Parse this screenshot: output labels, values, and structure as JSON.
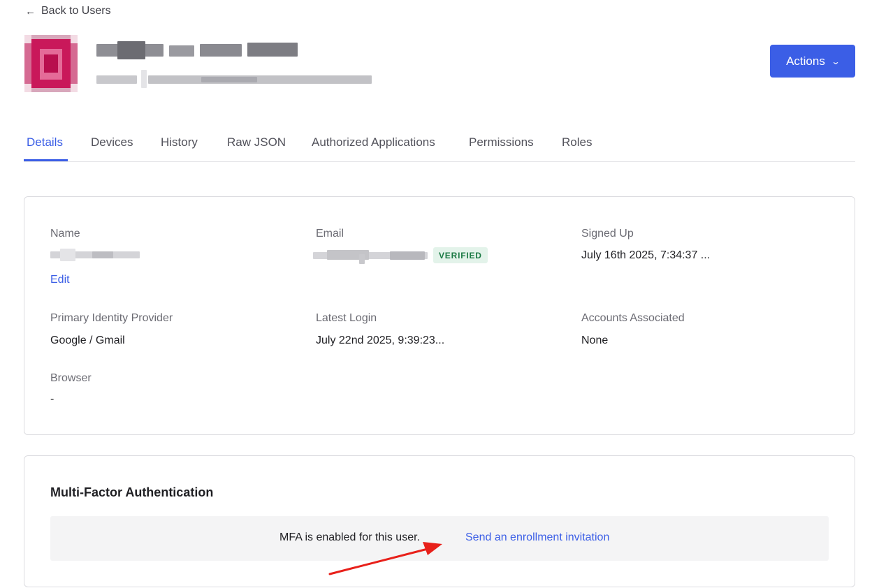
{
  "header": {
    "back_label": "Back to Users",
    "back_icon": "arrow-left-icon",
    "actions_label": "Actions",
    "actions_icon": "chevron-down-icon",
    "accent_color": "#3b5ee6"
  },
  "tabs": [
    {
      "label": "Details",
      "active": true
    },
    {
      "label": "Devices",
      "active": false
    },
    {
      "label": "History",
      "active": false
    },
    {
      "label": "Raw JSON",
      "active": false
    },
    {
      "label": "Authorized Applications",
      "active": false
    },
    {
      "label": "Permissions",
      "active": false
    },
    {
      "label": "Roles",
      "active": false
    }
  ],
  "details": {
    "name": {
      "label": "Name",
      "edit_label": "Edit"
    },
    "email": {
      "label": "Email",
      "badge": "VERIFIED"
    },
    "signed_up": {
      "label": "Signed Up",
      "value": "July 16th 2025, 7:34:37 ..."
    },
    "primary_idp": {
      "label": "Primary Identity Provider",
      "value": "Google / Gmail"
    },
    "latest_login": {
      "label": "Latest Login",
      "value": "July 22nd 2025, 9:39:23..."
    },
    "accounts_associated": {
      "label": "Accounts Associated",
      "value": "None"
    },
    "browser": {
      "label": "Browser",
      "value": "-"
    }
  },
  "mfa": {
    "title": "Multi-Factor Authentication",
    "status_text": "MFA is enabled for this user.",
    "invite_link": "Send an enrollment invitation"
  },
  "annotation": {
    "arrow_color": "#e8201a"
  }
}
